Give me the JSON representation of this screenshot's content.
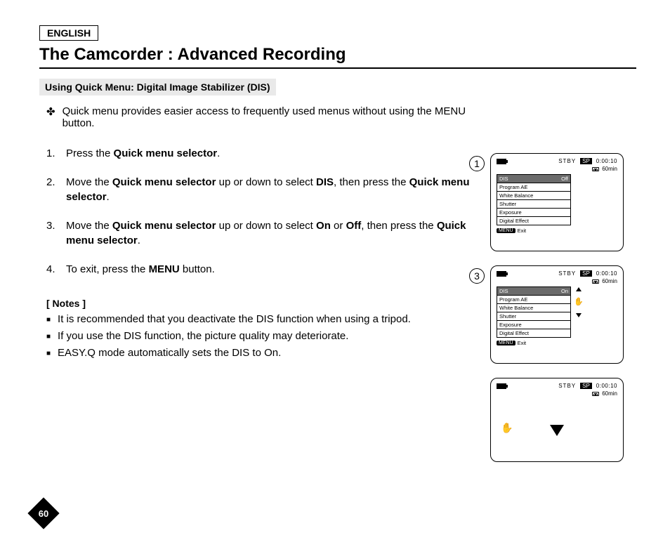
{
  "lang": "ENGLISH",
  "title": "The Camcorder : Advanced Recording",
  "subhead": "Using Quick Menu: Digital Image Stabilizer (DIS)",
  "intro_bullet": "✤",
  "intro": "Quick menu provides easier access to frequently used menus without using the MENU button.",
  "steps": [
    {
      "num": "1.",
      "pre": "Press the ",
      "b1": "Quick menu selector",
      "post": "."
    },
    {
      "num": "2.",
      "pre": "Move the ",
      "b1": "Quick menu selector",
      "mid1": " up or down to select ",
      "b2": "DIS",
      "mid2": ", then press the ",
      "b3": "Quick menu selector",
      "post": "."
    },
    {
      "num": "3.",
      "pre": "Move the ",
      "b1": "Quick menu selector",
      "mid1": " up or down to select ",
      "b2": "On",
      "mid2": " or ",
      "b3": "Off",
      "mid3": ", then press the ",
      "b4": "Quick menu selector",
      "post": "."
    },
    {
      "num": "4.",
      "pre": "To exit, press the ",
      "b1": "MENU",
      "post": " button."
    }
  ],
  "notes_head": "[ Notes ]",
  "notes": [
    "It is recommended that you deactivate the DIS function when using a tripod.",
    "If you use the DIS function, the picture quality may deteriorate.",
    "EASY.Q mode automatically sets the DIS to On."
  ],
  "circle1": "1",
  "circle3": "3",
  "osd": {
    "stby": "STBY",
    "sp": "SP",
    "time": "0:00:10",
    "remain": "60min",
    "menu": "MENU",
    "exit": "Exit",
    "items": [
      "DIS",
      "Program AE",
      "White Balance",
      "Shutter",
      "Exposure",
      "Digital Effect"
    ],
    "val_off": "Off",
    "val_on": "On"
  },
  "page": "60"
}
